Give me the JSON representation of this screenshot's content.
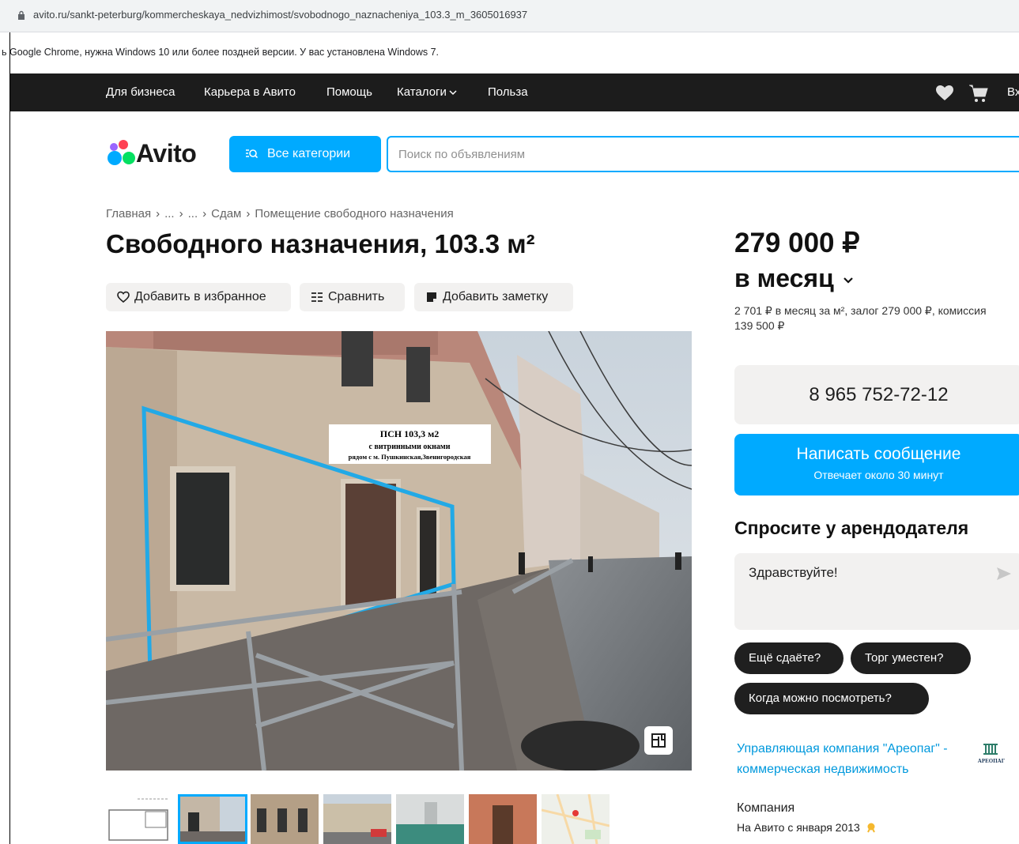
{
  "browser": {
    "url": "avito.ru/sankt-peterburg/kommercheskaya_nedvizhimost/svobodnogo_naznacheniya_103.3_m_3605016937",
    "info_bar": "ь Google Chrome, нужна Windows 10 или более поздней версии. У вас установлена Windows 7."
  },
  "topnav": {
    "links": [
      "Для бизнеса",
      "Карьера в Авито",
      "Помощь",
      "Каталоги",
      "Польза"
    ],
    "login_partial": "Вх"
  },
  "header": {
    "logo": "Avito",
    "categories_button": "Все категории",
    "search_placeholder": "Поиск по объявлениям"
  },
  "breadcrumbs": [
    "Главная",
    "...",
    "...",
    "Сдам",
    "Помещение свободного назначения"
  ],
  "listing": {
    "title": "Свободного назначения, 103.3 м²",
    "actions": {
      "favorite": "Добавить в избранное",
      "compare": "Сравнить",
      "note": "Добавить заметку"
    },
    "photo_sign": {
      "line1": "ПСН 103,3 м2",
      "line2": "с витринными окнами",
      "line3": "рядом с м. Пушкинская,Звенигородская"
    }
  },
  "pricing": {
    "price": "279 000 ₽",
    "period": "в месяц",
    "details": "2 701 ₽ в месяц за м², залог 279 000 ₽, комиссия 139 500 ₽"
  },
  "contact": {
    "phone": "8 965 752-72-12",
    "message_button": "Написать сообщение",
    "message_subtitle": "Отвечает около 30 минут"
  },
  "ask": {
    "title": "Спросите у арендодателя",
    "input_value": "Здравствуйте!",
    "chips": [
      "Ещё сдаёте?",
      "Торг уместен?",
      "Когда можно посмотреть?"
    ]
  },
  "seller": {
    "name": "Управляющая компания \"Ареопаг\" - коммерческая недвижимость",
    "type": "Компания",
    "since": "На Авито с января 2013",
    "logo_text": "АРЕОПАГ"
  },
  "colors": {
    "accent": "#00aaff",
    "nav_bg": "#1c1c1c",
    "button_bg": "#f2f1f0",
    "link": "#0099dd"
  }
}
